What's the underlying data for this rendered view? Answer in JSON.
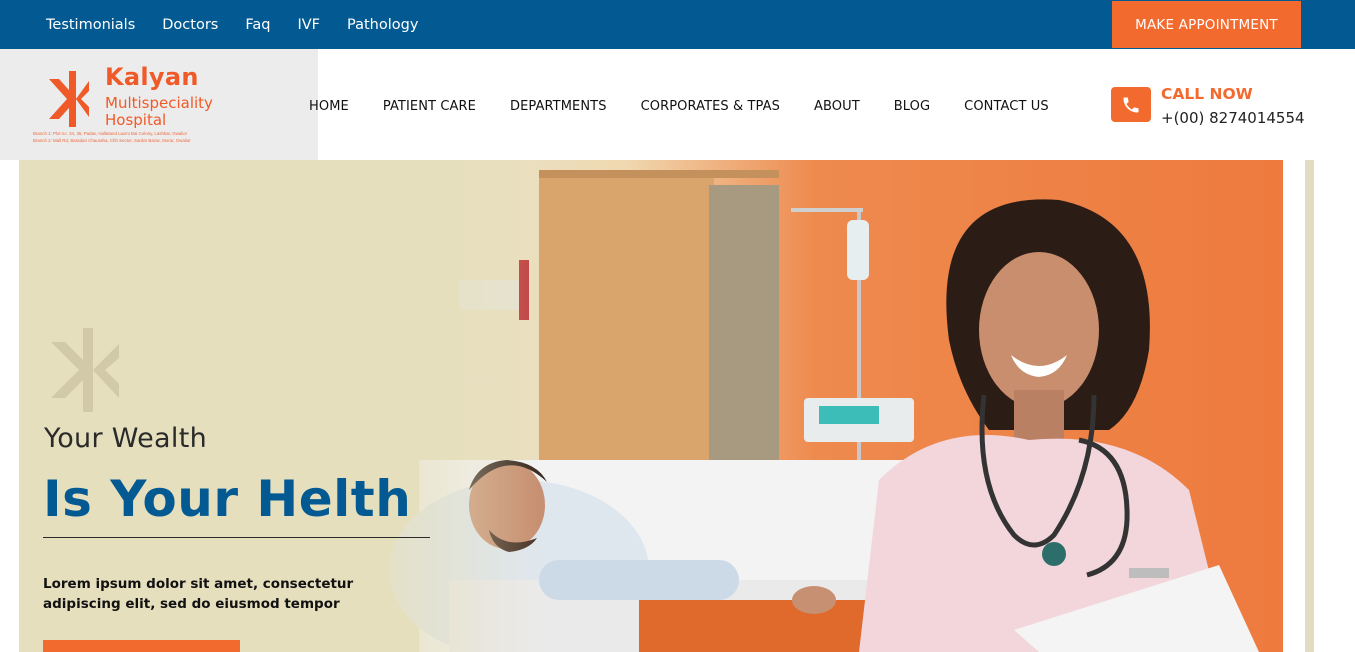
{
  "topbar": {
    "links": [
      "Testimonials",
      "Doctors",
      "Faq",
      "IVF",
      "Pathology"
    ],
    "appointment_label": "MAKE APPOINTMENT",
    "background": "#035a92",
    "accent": "#f26a2e"
  },
  "logo": {
    "name": "Kalyan",
    "line1": "Multispeciality",
    "line2": "Hospital",
    "address1": "Branch 1: Plot no. 34, 35, Padav, Hallatand Laxmi Bai Colony, Lashkar, Gwalior",
    "address2": "Branch 2: Mall Rd, Baradari Chauraha, Chh Sector, Sardar Bazar, Morar, Gwalior",
    "color": "#f05a28"
  },
  "nav": {
    "items": [
      "HOME",
      "PATIENT CARE",
      "DEPARTMENTS",
      "CORPORATES & TPAS",
      "ABOUT",
      "BLOG",
      "CONTACT US"
    ]
  },
  "call": {
    "icon": "phone-icon",
    "label": "CALL NOW",
    "number": "+(00) 8274014554"
  },
  "hero": {
    "subtitle": "Your Wealth",
    "title": "Is Your Helth",
    "text": "Lorem ipsum dolor sit amet, consectetur adipiscing elit, sed do eiusmod tempor",
    "title_color": "#035a92"
  }
}
